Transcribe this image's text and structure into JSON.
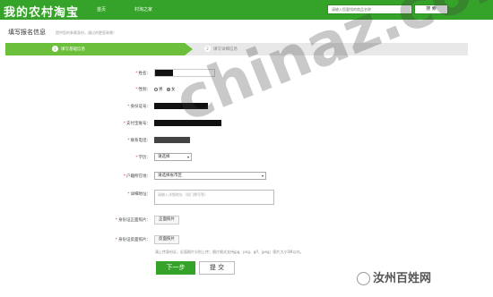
{
  "header": {
    "logo": "我的农村淘宝",
    "nav": [
      "首页",
      "村淘之家"
    ],
    "search_placeholder": "请输入您要找的商品名称",
    "search_button": "搜 索"
  },
  "page": {
    "title": "填写报名信息",
    "subtitle": "提供您的参赛身份，通过的更容易哦！"
  },
  "steps": [
    {
      "num": "1",
      "label": "填写基础信息"
    },
    {
      "num": "2",
      "label": "填写详细信息"
    }
  ],
  "form": {
    "name_label": "姓名",
    "gender_label": "性别",
    "gender_male": "男",
    "gender_female": "女",
    "id_label": "身份证号",
    "alipay_label": "支付宝账号",
    "phone_label": "联系电话",
    "education_label": "学历",
    "education_value": "请选择",
    "address_label": "户籍所在地",
    "address_value": "请选择省市区",
    "detail_label": "详细地址",
    "detail_placeholder": "请输入详细地址（如门牌号等）",
    "id_front_label": "身份证正面照片",
    "id_front_button": "正面照片",
    "id_back_label": "身份证反面照片",
    "id_back_button": "反面照片",
    "upload_note": "请上传身份证，反面照片分别上传；图片格式支持jpg、png、gif、jpeg；图片大小5M以内。"
  },
  "buttons": {
    "next": "下一步",
    "submit": "提 交"
  },
  "watermark": {
    "text": "chinaz.com",
    "caption": "汝州百姓网"
  },
  "colors": {
    "brand_green": "#35a229",
    "step_green": "#6cbf3b"
  }
}
